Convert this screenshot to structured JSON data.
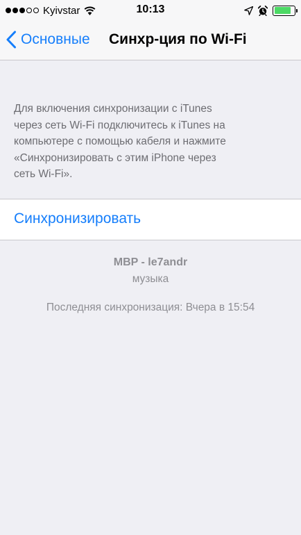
{
  "status_bar": {
    "signal_bars_filled": 3,
    "signal_bars_total": 5,
    "carrier": "Kyivstar",
    "time": "10:13",
    "battery_level": 0.85,
    "battery_color": "#4cd964",
    "icons": [
      "wifi-icon",
      "location-arrow-icon",
      "alarm-clock-icon",
      "battery-icon"
    ]
  },
  "nav": {
    "back_label": "Основные",
    "title": "Синхр-ция по Wi-Fi",
    "accent_color": "#157efb"
  },
  "description": {
    "lines": [
      "Для включения синхронизации с iTunes",
      "через сеть Wi-Fi подключитесь к iTunes на",
      "компьютере с помощью кабеля и нажмите",
      "«Синхронизировать с этим iPhone через",
      "сеть Wi-Fi»."
    ]
  },
  "sync": {
    "button_label": "Синхронизировать"
  },
  "info": {
    "device_name": "MBP - le7andr",
    "content_type": "музыка",
    "last_sync": "Последняя синхронизация: Вчера в 15:54"
  }
}
